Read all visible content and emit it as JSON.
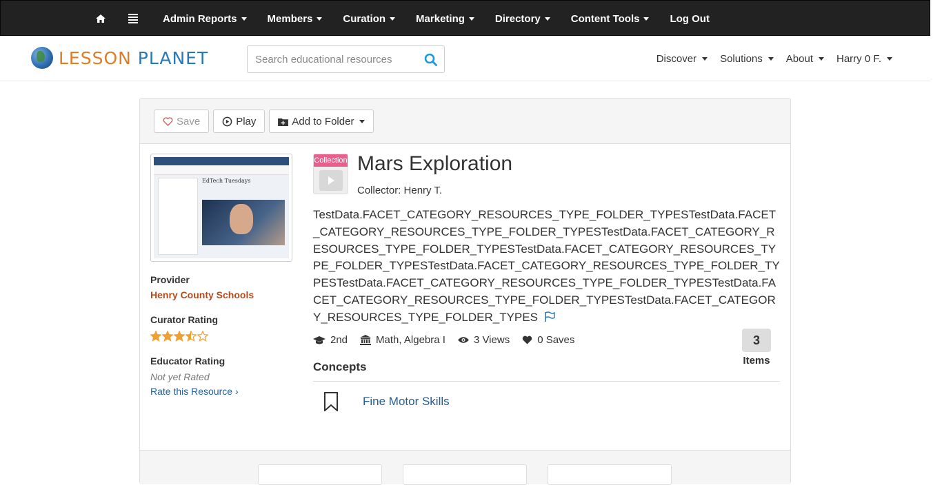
{
  "admin_bar": {
    "items": [
      {
        "label": "Admin Reports"
      },
      {
        "label": "Members"
      },
      {
        "label": "Curation"
      },
      {
        "label": "Marketing"
      },
      {
        "label": "Directory"
      },
      {
        "label": "Content Tools"
      },
      {
        "label": "Log Out"
      }
    ]
  },
  "header": {
    "logo_part1": "LESSON",
    "logo_part2": "PLANET",
    "search_placeholder": "Search educational resources",
    "nav": [
      {
        "label": "Discover"
      },
      {
        "label": "Solutions"
      },
      {
        "label": "About"
      },
      {
        "label": "Harry 0 F."
      }
    ]
  },
  "toolbar": {
    "save_label": "Save",
    "play_label": "Play",
    "folder_label": "Add to Folder"
  },
  "sidebar": {
    "thumb_title": "EdTech Tuesdays",
    "provider_label": "Provider",
    "provider_name": "Henry County Schools",
    "curator_label": "Curator Rating",
    "curator_rating": 3.5,
    "curator_max": 5,
    "educator_label": "Educator Rating",
    "educator_value": "Not yet Rated",
    "rate_link": "Rate this Resource ›"
  },
  "resource": {
    "badge": "Collection",
    "title": "Mars Exploration",
    "collector": "Collector: Henry T.",
    "description": "TestData.FACET_CATEGORY_RESOURCES_TYPE_FOLDER_TYPESTestData.FACET_CATEGORY_RESOURCES_TYPE_FOLDER_TYPESTestData.FACET_CATEGORY_RESOURCES_TYPE_FOLDER_TYPESTestData.FACET_CATEGORY_RESOURCES_TYPE_FOLDER_TYPESTestData.FACET_CATEGORY_RESOURCES_TYPE_FOLDER_TYPESTestData.FACET_CATEGORY_RESOURCES_TYPE_FOLDER_TYPESTestData.FACET_CATEGORY_RESOURCES_TYPE_FOLDER_TYPESTestData.FACET_CATEGORY_RESOURCES_TYPE_FOLDER_TYPES",
    "grade": "2nd",
    "subject": "Math, Algebra I",
    "views": "3 Views",
    "saves": "0 Saves",
    "items_count": "3",
    "items_label": "Items",
    "concepts_heading": "Concepts",
    "concepts": [
      {
        "label": "Fine Motor Skills"
      }
    ]
  },
  "colors": {
    "admin_bg": "#222222",
    "accent_orange": "#e07b26",
    "accent_blue": "#2a78b8",
    "link": "#1f5fa0",
    "provider": "#b24c1e",
    "star": "#f0a030",
    "badge": "#e85f8e"
  }
}
